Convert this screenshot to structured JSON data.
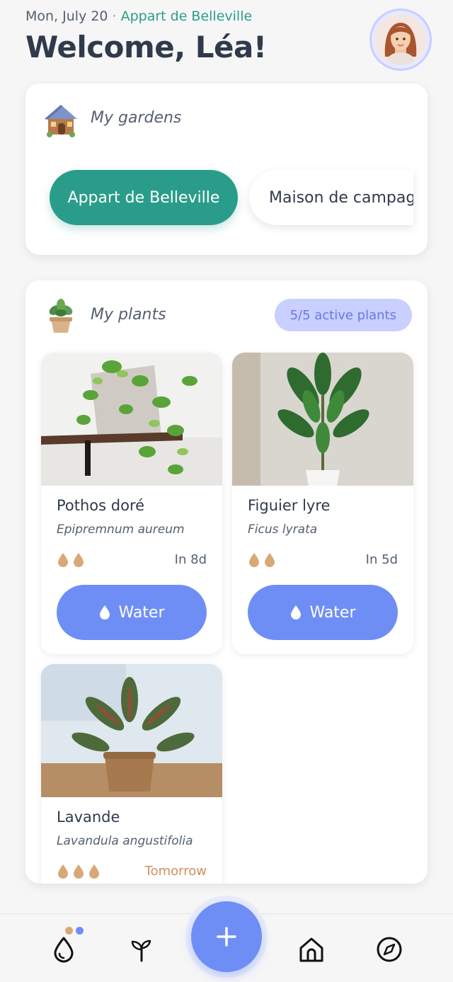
{
  "header": {
    "date": "Mon, July 20",
    "separator": "·",
    "current_garden": "Appart de Belleville",
    "welcome": "Welcome, Léa!"
  },
  "gardens": {
    "title": "My gardens",
    "items": [
      {
        "label": "Appart de Belleville",
        "active": true
      },
      {
        "label": "Maison de campagr",
        "active": false
      }
    ]
  },
  "plants": {
    "title": "My plants",
    "badge": "5/5 active plants",
    "items": [
      {
        "name": "Pothos doré",
        "latin": "Epipremnum aureum",
        "drops": 2,
        "next_water": "In 8d",
        "action": "Water"
      },
      {
        "name": "Figuier lyre",
        "latin": "Ficus lyrata",
        "drops": 2,
        "next_water": "In 5d",
        "action": "Water"
      },
      {
        "name": "Lavande",
        "latin": "Lavandula angustifolia",
        "drops": 3,
        "next_water": "Tomorrow"
      }
    ]
  },
  "nav": {
    "items": [
      "water-drop-icon",
      "sprout-icon",
      "add-icon",
      "home-icon",
      "compass-icon"
    ],
    "fab_symbol": "+"
  },
  "colors": {
    "accent_green": "#2a9d8a",
    "accent_blue": "#6f8ef5",
    "badge_bg": "#c9cfff",
    "drop_color": "#d9a877",
    "tomorrow_color": "#d1905c"
  }
}
